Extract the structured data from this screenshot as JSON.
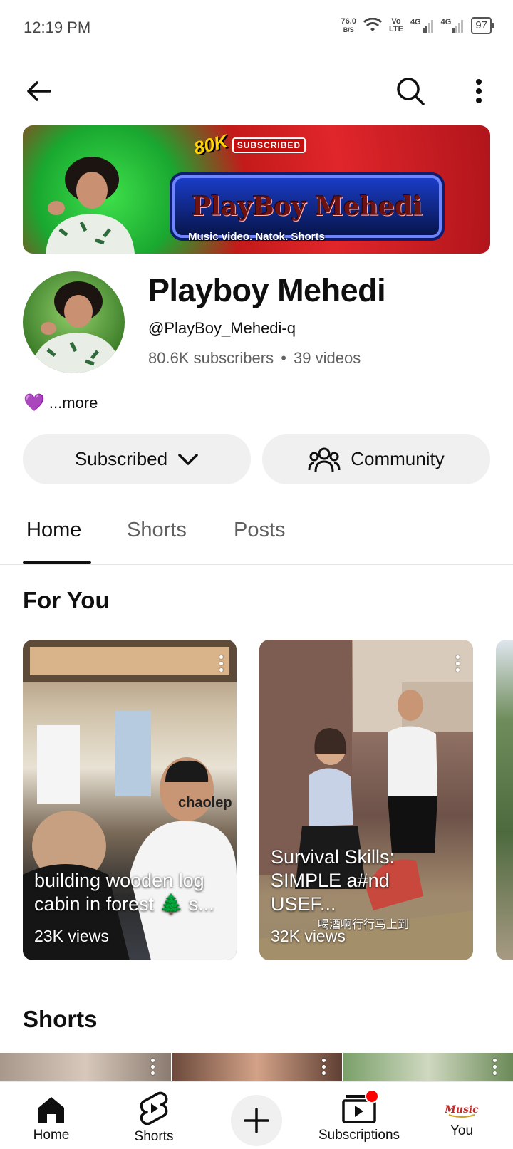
{
  "status_bar": {
    "time": "12:19 PM",
    "net_speed_value": "76.0",
    "net_speed_unit": "B/S",
    "volte_top": "Vo",
    "volte_bottom": "LTE",
    "sim1": "4G",
    "sim2": "4G",
    "battery": "97"
  },
  "top_bar": {
    "back_icon": "arrow-left-icon",
    "search_icon": "search-icon",
    "more_icon": "more-vert-icon"
  },
  "banner": {
    "badge_count": "80K",
    "badge_label": "SUBSCRIBED",
    "title": "PlayBoy Mehedi",
    "tagline": "Music video. Natok. Shorts"
  },
  "channel": {
    "name": "Playboy Mehedi",
    "handle": "@PlayBoy_Mehedi-q",
    "subscribers": "80.6K subscribers",
    "separator": "•",
    "videos": "39 videos",
    "description_emoji": "💜",
    "more_label": "...more"
  },
  "actions": {
    "subscribed_label": "Subscribed",
    "community_label": "Community"
  },
  "tabs": [
    {
      "label": "Home",
      "active": true
    },
    {
      "label": "Shorts",
      "active": false
    },
    {
      "label": "Posts",
      "active": false
    }
  ],
  "for_you": {
    "title": "For You",
    "cards": [
      {
        "title": "building wooden log cabin in forest 🌲 s...",
        "views": "23K views"
      },
      {
        "title": "Survival Skills: SIMPLE a#nd USEF...",
        "views": "32K views",
        "caption": "喝酒啊行行马上到"
      }
    ],
    "shirt_text": "chaolep"
  },
  "shorts_section": {
    "title": "Shorts"
  },
  "bottom_nav": [
    {
      "label": "Home",
      "icon": "home-icon"
    },
    {
      "label": "Shorts",
      "icon": "shorts-icon"
    },
    {
      "label": "",
      "icon": "create-plus-icon"
    },
    {
      "label": "Subscriptions",
      "icon": "subscriptions-icon"
    },
    {
      "label": "You",
      "icon": "profile-avatar-icon"
    }
  ],
  "colors": {
    "accent_red": "#ff0000",
    "text_primary": "#0f0f0f",
    "text_secondary": "#606060",
    "pill_bg": "#f0f0f0"
  }
}
